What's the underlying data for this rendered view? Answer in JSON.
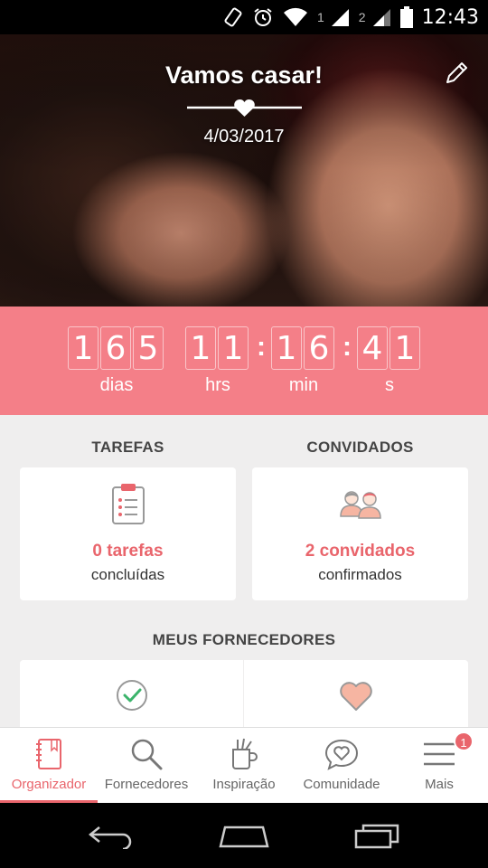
{
  "status_bar": {
    "sim1": "1",
    "sim2": "2",
    "time": "12:43",
    "icons": [
      "rotation-icon",
      "alarm-icon",
      "wifi-icon",
      "signal-icon",
      "signal-icon",
      "battery-icon"
    ]
  },
  "hero": {
    "title": "Vamos casar!",
    "date": "4/03/2017",
    "edit_icon": "pencil-icon"
  },
  "countdown": {
    "days": [
      "1",
      "6",
      "5"
    ],
    "hours": [
      "1",
      "1"
    ],
    "minutes": [
      "1",
      "6"
    ],
    "seconds": [
      "4",
      "1"
    ],
    "labels": {
      "days": "dias",
      "hours": "hrs",
      "minutes": "min",
      "seconds": "s"
    },
    "separator": ":"
  },
  "tasks": {
    "title": "TAREFAS",
    "count": "0 tarefas",
    "sub": "concluídas",
    "icon": "clipboard-icon"
  },
  "guests": {
    "title": "CONVIDADOS",
    "count": "2 convidados",
    "sub": "confirmados",
    "icon": "couple-icon"
  },
  "vendors": {
    "title": "MEUS FORNECEDORES",
    "cards": [
      {
        "icon": "check-circle-icon"
      },
      {
        "icon": "heart-icon"
      }
    ]
  },
  "bottom_nav": {
    "items": [
      {
        "label": "Organizador",
        "icon": "notebook-icon",
        "active": true
      },
      {
        "label": "Fornecedores",
        "icon": "search-icon"
      },
      {
        "label": "Inspiração",
        "icon": "brush-cup-icon"
      },
      {
        "label": "Comunidade",
        "icon": "chat-heart-icon"
      },
      {
        "label": "Mais",
        "icon": "menu-icon",
        "badge": "1"
      }
    ]
  },
  "colors": {
    "accent": "#e9656c",
    "countdown_bg": "#f47f88",
    "content_bg": "#efeeee"
  }
}
